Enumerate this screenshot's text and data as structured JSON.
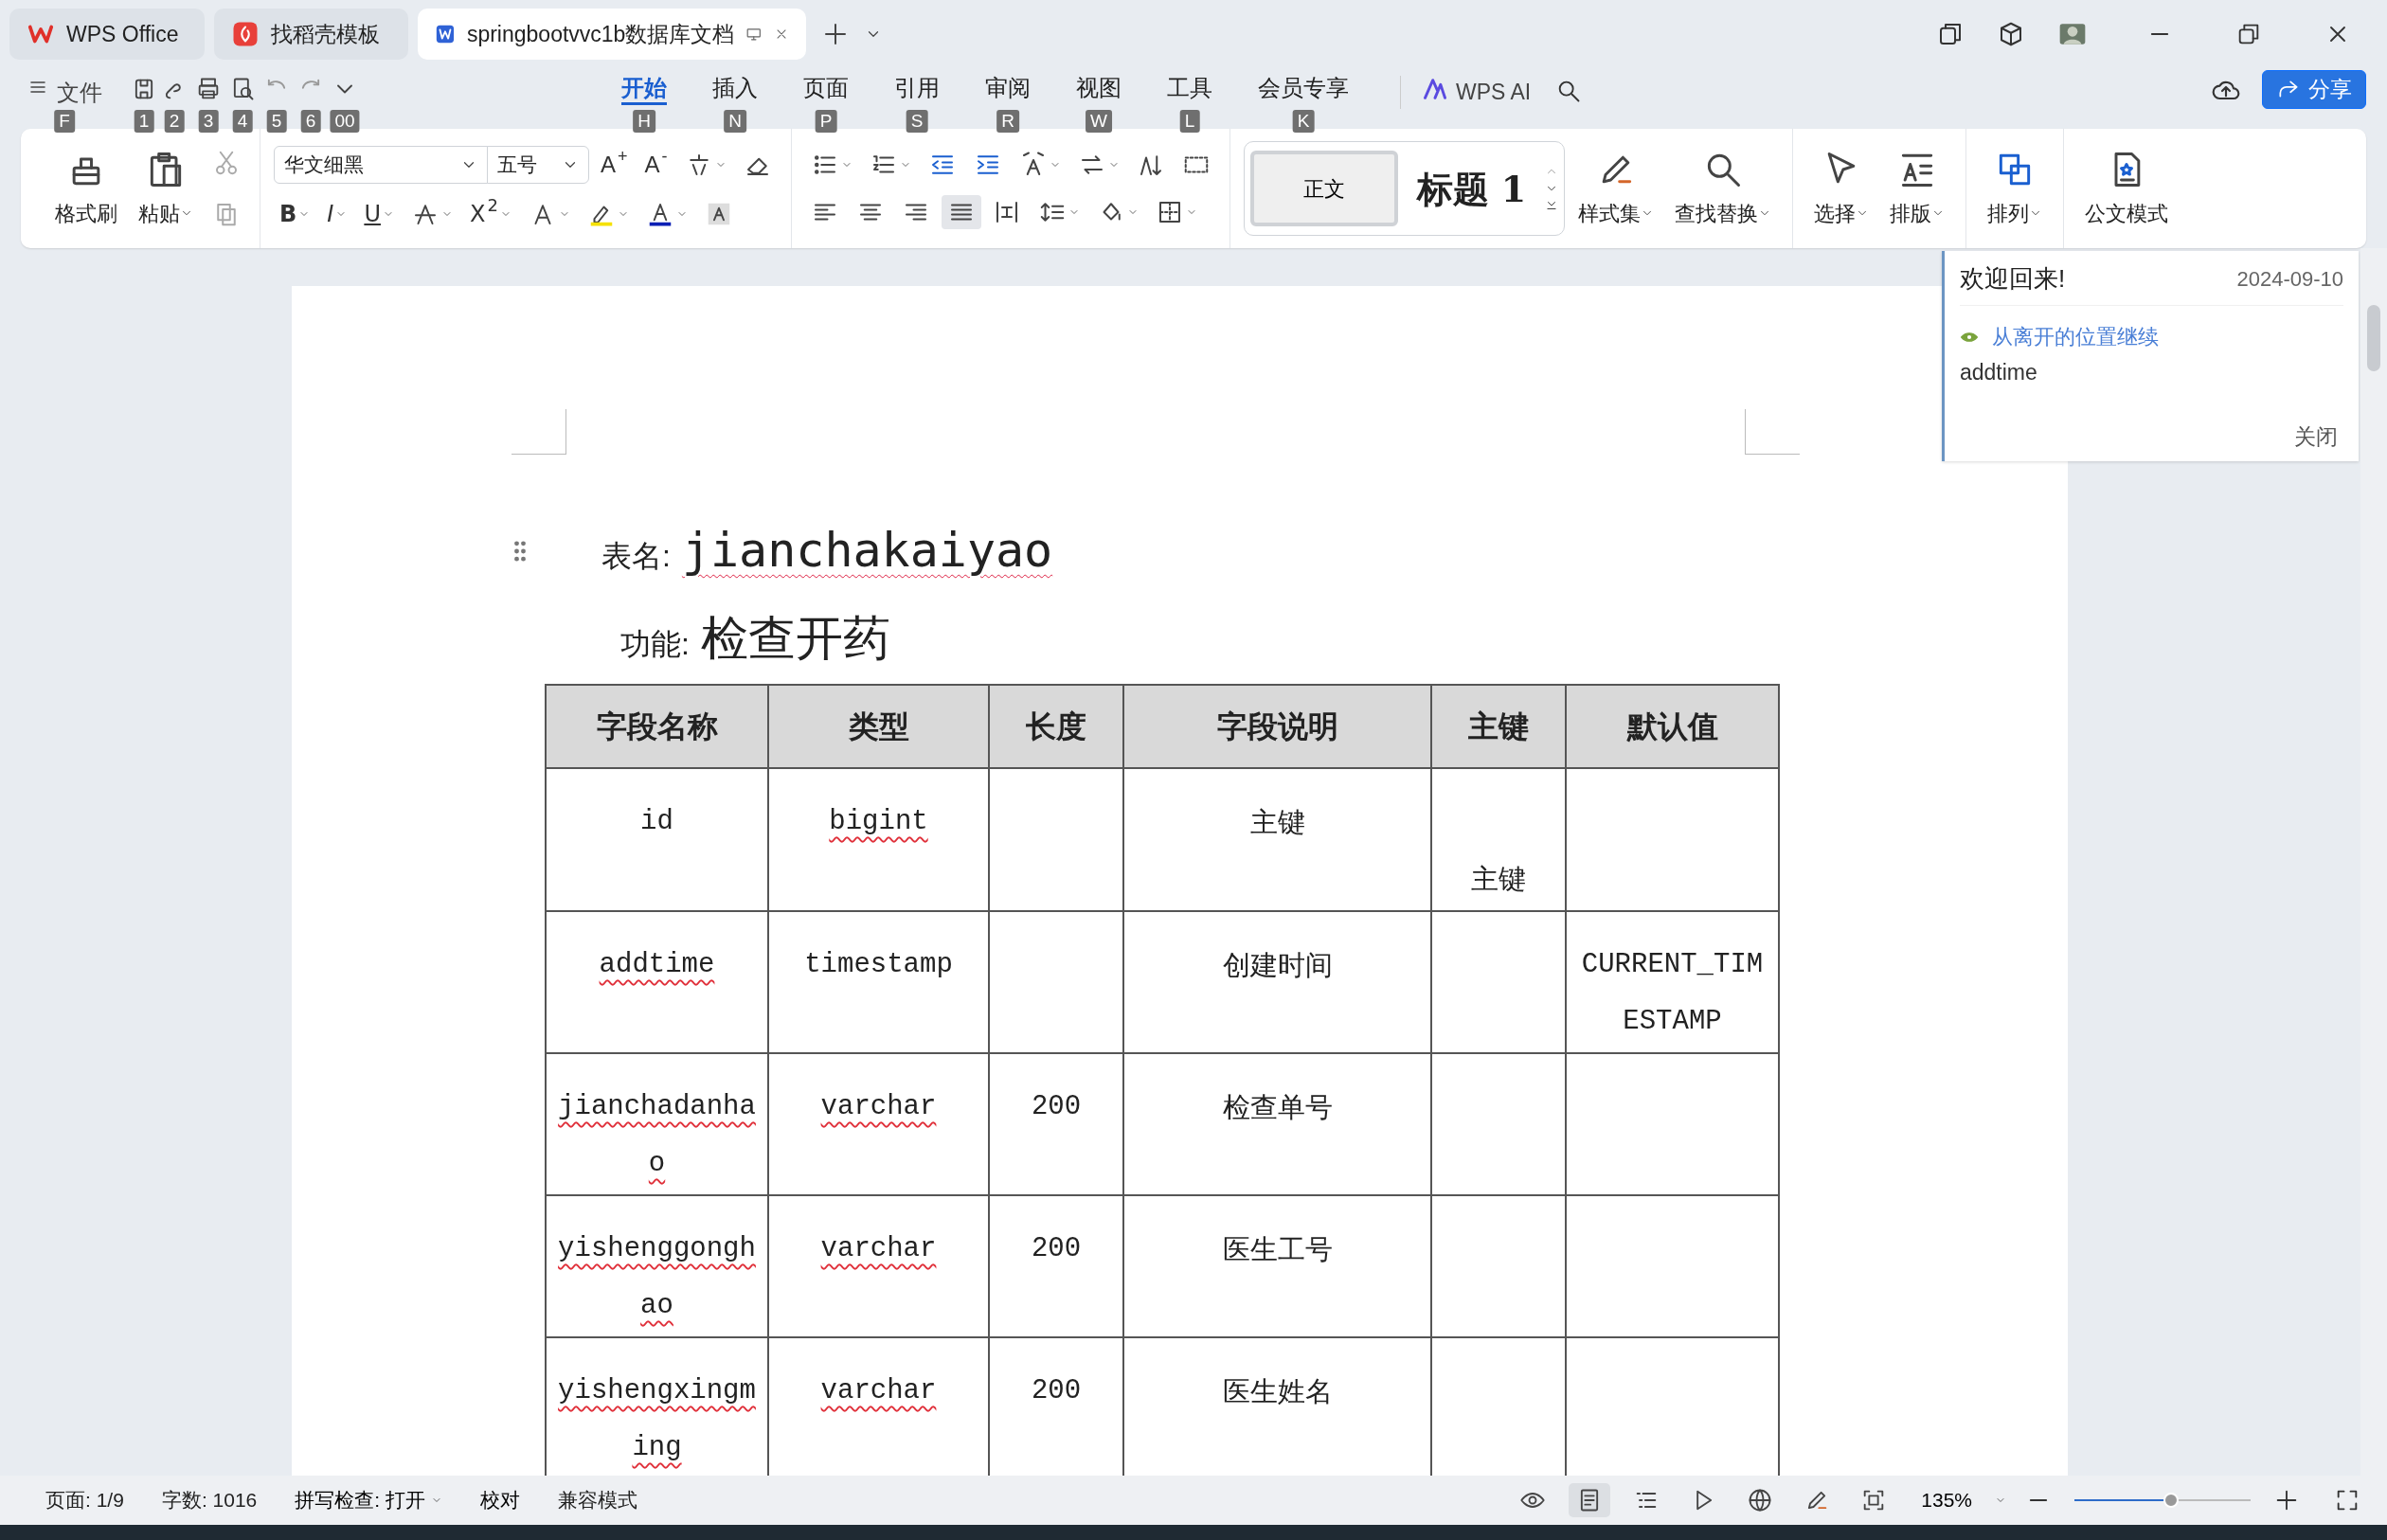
{
  "app_tabs": [
    {
      "label": "WPS Office",
      "kind": "wps",
      "selected": false
    },
    {
      "label": "找稻壳模板",
      "kind": "docer",
      "selected": false
    },
    {
      "label": "springbootvvc1b数据库文档",
      "kind": "writer",
      "selected": true
    }
  ],
  "menu": {
    "file_label": "文件",
    "file_key": "F",
    "quick_keys": [
      "1",
      "2",
      "3",
      "4",
      "5",
      "6",
      "00"
    ],
    "tabs": [
      {
        "label": "开始",
        "key": "H",
        "selected": true
      },
      {
        "label": "插入",
        "key": "N",
        "selected": false
      },
      {
        "label": "页面",
        "key": "P",
        "selected": false
      },
      {
        "label": "引用",
        "key": "S",
        "selected": false
      },
      {
        "label": "审阅",
        "key": "R",
        "selected": false
      },
      {
        "label": "视图",
        "key": "W",
        "selected": false
      },
      {
        "label": "工具",
        "key": "L",
        "selected": false
      },
      {
        "label": "会员专享",
        "key": "K",
        "selected": false
      }
    ],
    "ai_label": "WPS AI",
    "share_label": "分享"
  },
  "ribbon": {
    "format_painter": "格式刷",
    "paste": "粘贴",
    "font": "华文细黑",
    "size": "五号",
    "size_glyphs": [
      "A$^{+}$",
      "A$^{-}$"
    ],
    "format_glyphs": [
      "B",
      "I",
      "U",
      "X$^{2}$"
    ],
    "alignments": [
      {
        "selected": false
      },
      {
        "selected": false
      },
      {
        "selected": false
      },
      {
        "selected": true
      },
      {
        "selected": false
      }
    ],
    "style_normal": "正文",
    "style_heading": "标题 1",
    "tools": [
      {
        "label": "样式集",
        "has_menu": true
      },
      {
        "label": "查找替换",
        "has_menu": true
      },
      {
        "label": "选择",
        "has_menu": true
      },
      {
        "label": "排版",
        "has_menu": true
      },
      {
        "label": "排列",
        "has_menu": true
      },
      {
        "label": "公文模式",
        "has_menu": false
      }
    ]
  },
  "document": {
    "name_label": "表名:",
    "table_name": "jianchakaiyao",
    "function_label": "功能:",
    "function": "检查开药",
    "table": {
      "columns": [
        "字段名称",
        "类型",
        "长度",
        "字段说明",
        "主键",
        "默认值"
      ],
      "rows": [
        {
          "name": {
            "text": "id",
            "flagged": false
          },
          "type": {
            "text": "bigint",
            "flagged": true
          },
          "description": "主键",
          "key": "主键"
        },
        {
          "name": {
            "text": "addtime",
            "flagged": true
          },
          "type": {
            "text": "timestamp",
            "flagged": false
          },
          "description": "创建时间",
          "default": "CURRENT_TIMESTAMP"
        },
        {
          "name": {
            "text": "jianchadanhao",
            "flagged": true
          },
          "type": {
            "text": "varchar",
            "flagged": true
          },
          "length": "200",
          "description": "检查单号"
        },
        {
          "name": {
            "text": "yishenggonghao",
            "flagged": true
          },
          "type": {
            "text": "varchar",
            "flagged": true
          },
          "length": "200",
          "description": "医生工号"
        },
        {
          "name": {
            "text": "yishengxingming",
            "flagged": true
          },
          "type": {
            "text": "varchar",
            "flagged": true
          },
          "length": "200",
          "description": "医生姓名"
        }
      ]
    }
  },
  "notice": {
    "title": "欢迎回来!",
    "date": "2024-09-10",
    "link": "从离开的位置继续",
    "detail": "addtime",
    "close": "关闭"
  },
  "status_bar": {
    "page": "页面: 1/9",
    "words": "字数: 1016",
    "spell": "拼写检查: 打开",
    "proofread": "校对",
    "compat": "兼容模式",
    "views": [
      {
        "selected": false
      },
      {
        "selected": true
      },
      {
        "selected": false
      },
      {
        "selected": false
      },
      {
        "selected": false
      },
      {
        "selected": false
      },
      {
        "selected": false
      }
    ],
    "zoom": "135%",
    "zoom_slider": {
      "level": 0.55
    }
  }
}
